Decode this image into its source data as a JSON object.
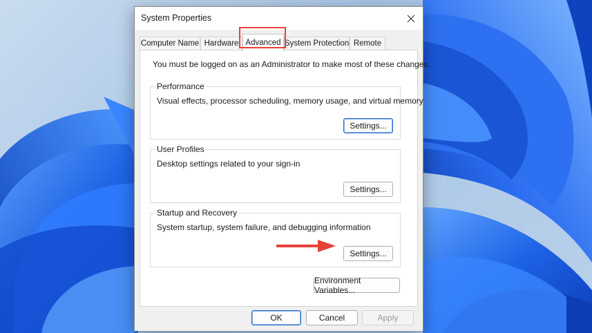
{
  "dialog": {
    "title": "System Properties",
    "tabs": [
      {
        "label": "Computer Name"
      },
      {
        "label": "Hardware"
      },
      {
        "label": "Advanced"
      },
      {
        "label": "System Protection"
      },
      {
        "label": "Remote"
      }
    ],
    "active_tab": "Advanced",
    "admin_note": "You must be logged on as an Administrator to make most of these changes.",
    "groups": {
      "performance": {
        "title": "Performance",
        "description": "Visual effects, processor scheduling, memory usage, and virtual memory",
        "button": "Settings..."
      },
      "user_profiles": {
        "title": "User Profiles",
        "description": "Desktop settings related to your sign-in",
        "button": "Settings..."
      },
      "startup_recovery": {
        "title": "Startup and Recovery",
        "description": "System startup, system failure, and debugging information",
        "button": "Settings..."
      }
    },
    "env_button": "Environment Variables...",
    "footer": {
      "ok": "OK",
      "cancel": "Cancel",
      "apply": "Apply"
    }
  },
  "colors": {
    "highlight_red": "#e8413a",
    "default_button_blue": "#2b6cc4",
    "wallpaper_blue": "#1a5fe0"
  },
  "icons": {
    "close": "close-icon",
    "annotation": "red-arrow-icon"
  }
}
